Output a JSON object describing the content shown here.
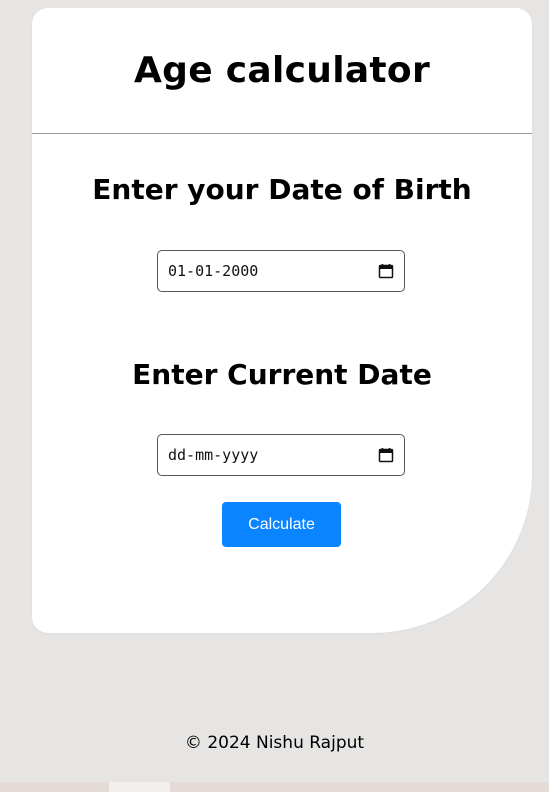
{
  "header": {
    "title": "Age calculator"
  },
  "birth": {
    "heading": "Enter your Date of Birth",
    "value": "01-01-2000"
  },
  "current": {
    "heading": "Enter Current Date",
    "placeholder": "dd-mm-yyyy"
  },
  "actions": {
    "calculate_label": "Calculate"
  },
  "footer": {
    "text": "© 2024 Nishu Rajput"
  },
  "colors": {
    "background": "#e6e5e3",
    "card": "#ffffff",
    "button": "#0a84ff"
  },
  "icons": {
    "date_picker": "calendar-icon"
  }
}
